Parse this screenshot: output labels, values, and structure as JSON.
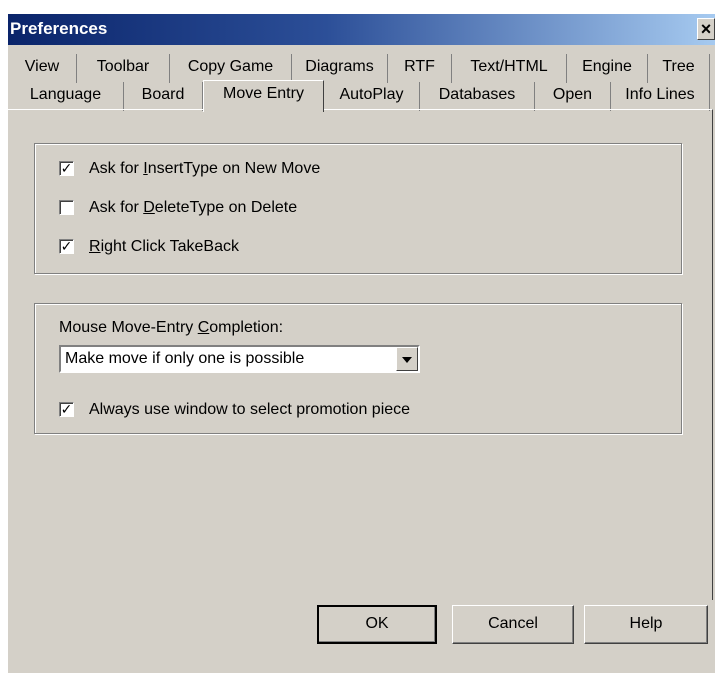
{
  "window": {
    "title": "Preferences",
    "close_glyph": "✕"
  },
  "tabs": {
    "row_back": [
      "View",
      "Toolbar",
      "Copy Game",
      "Diagrams",
      "RTF",
      "Text/HTML",
      "Engine",
      "Tree"
    ],
    "row_front": [
      "Language",
      "Board",
      "Move Entry",
      "AutoPlay",
      "Databases",
      "Open",
      "Info Lines"
    ],
    "active": "Move Entry"
  },
  "insert_options": [
    {
      "pre": "Ask for ",
      "ul": "I",
      "post": "nsertType on New Move",
      "checked": true
    },
    {
      "pre": "Ask for ",
      "ul": "D",
      "post": "eleteType on Delete",
      "checked": false
    },
    {
      "pre": "",
      "ul": "R",
      "post": "ight Click TakeBack",
      "checked": true
    }
  ],
  "completion": {
    "label_pre": "Mouse Move-Entry ",
    "label_ul": "C",
    "label_post": "ompletion:",
    "selected": "Make move if only one is possible",
    "promotion_label": "Always use window to select promotion piece",
    "promotion_checked": true
  },
  "buttons": {
    "ok": "OK",
    "cancel": "Cancel",
    "help": "Help"
  },
  "icons": {
    "check": "check-icon",
    "dropdown": "chevron-down-icon",
    "close": "close-icon"
  }
}
